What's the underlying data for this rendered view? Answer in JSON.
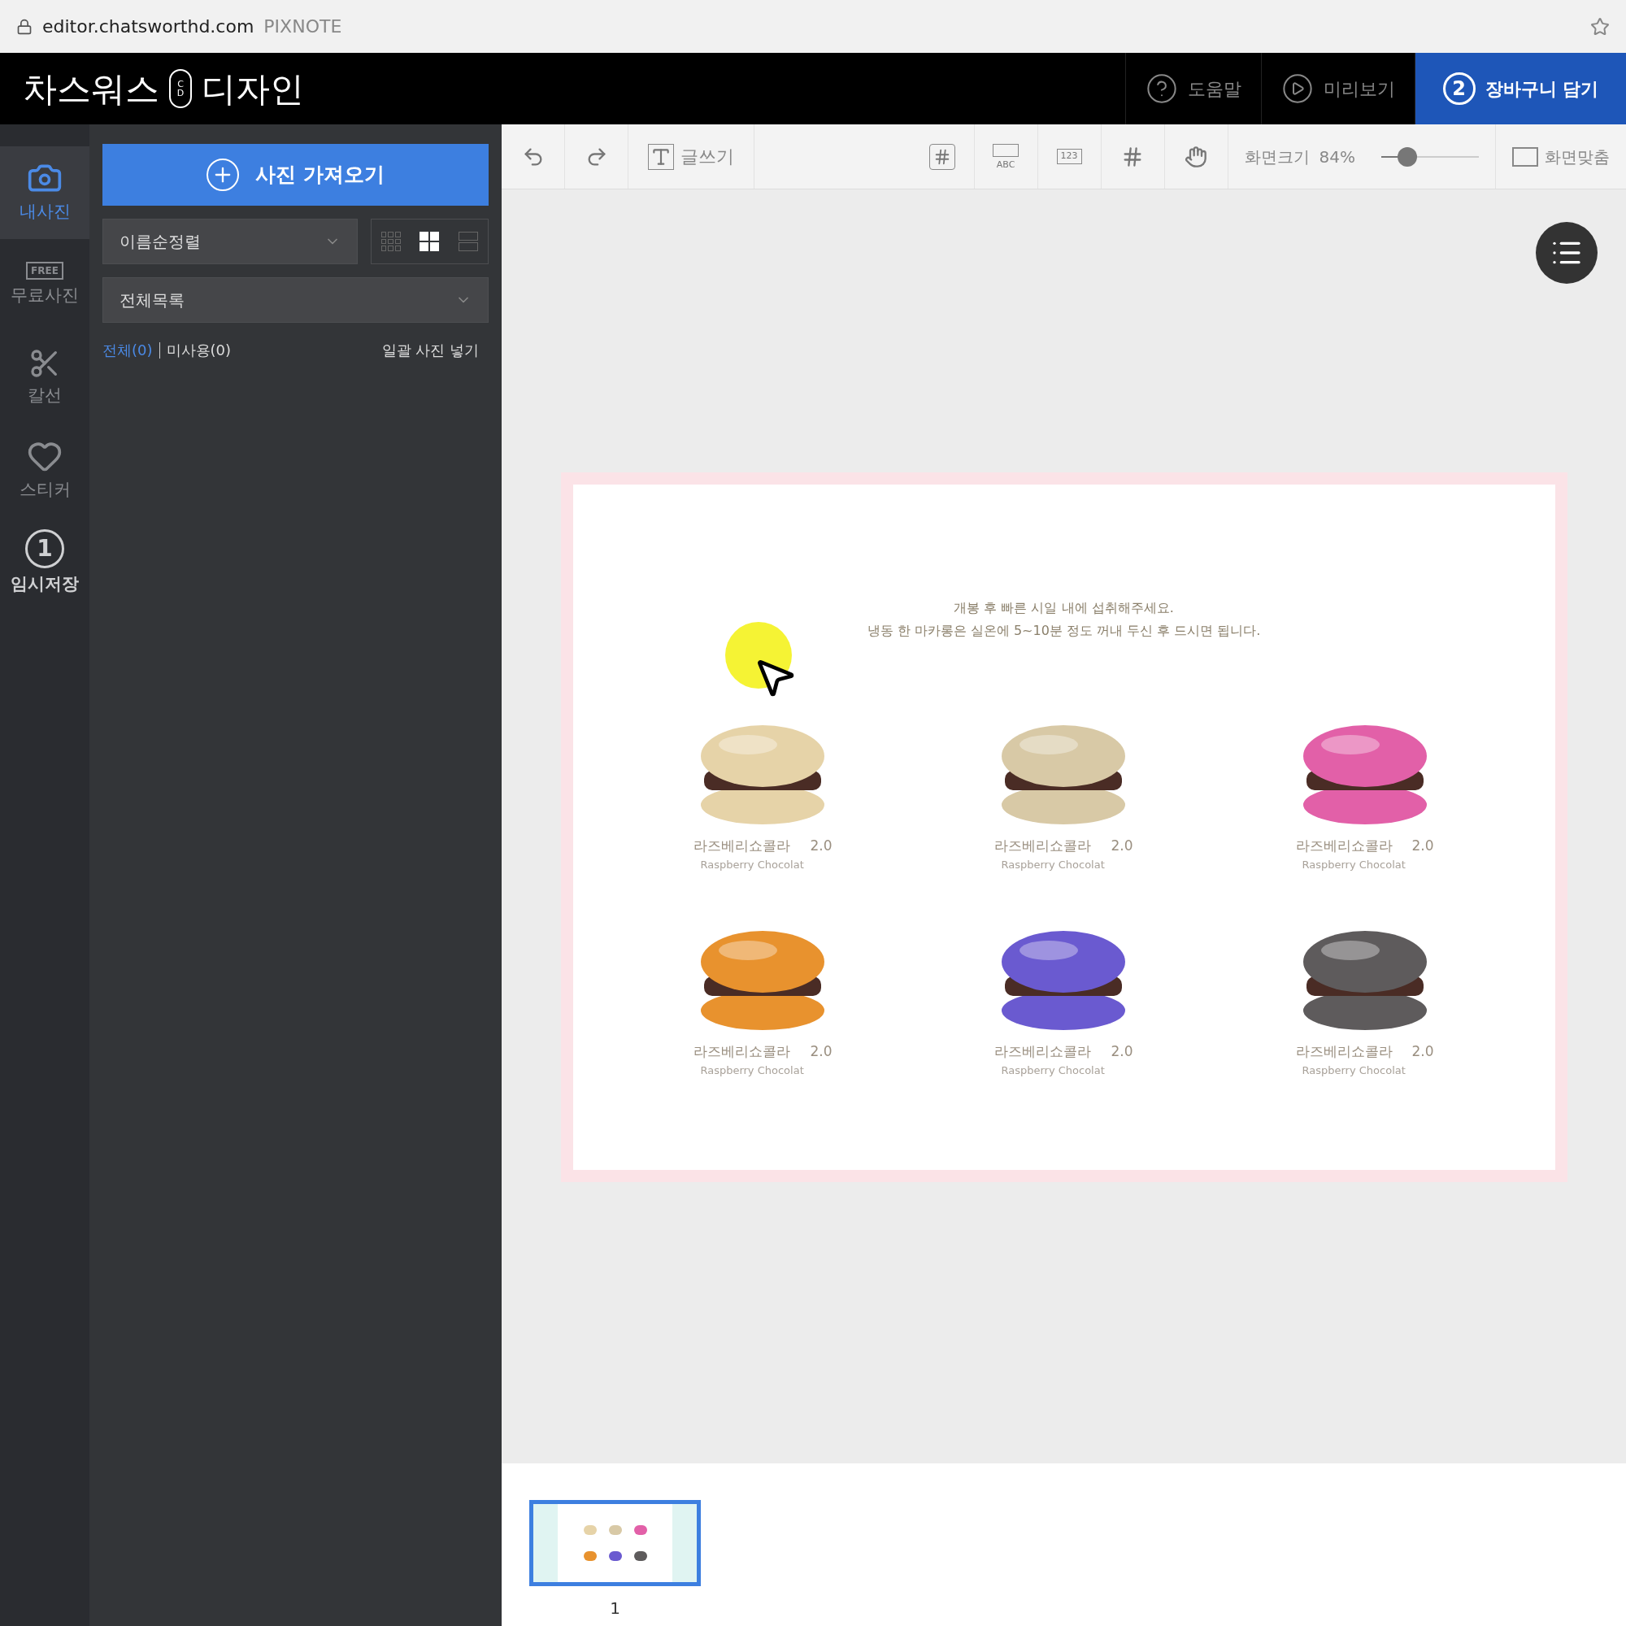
{
  "browser": {
    "url": "editor.chatsworthd.com",
    "title": "PIXNOTE"
  },
  "header": {
    "logo_left": "차스워스",
    "logo_mark": [
      "C",
      "D"
    ],
    "logo_right": "디자인",
    "buttons": [
      {
        "kind": "help",
        "label": "도움말"
      },
      {
        "kind": "preview",
        "label": "미리보기"
      },
      {
        "kind": "cart",
        "badge": "2",
        "label": "장바구니 담기"
      }
    ]
  },
  "rail": [
    {
      "kind": "photo",
      "label": "내사진",
      "selected": true
    },
    {
      "kind": "free",
      "badge": "FREE",
      "label": "무료사진",
      "selected": false
    },
    {
      "kind": "cutline",
      "label": "칼선",
      "selected": false
    },
    {
      "kind": "sticker",
      "label": "스티커",
      "selected": false
    },
    {
      "kind": "save",
      "badge": "1",
      "label": "임시저장",
      "selected": false
    }
  ],
  "panel": {
    "import_button": "사진 가져오기",
    "sort_select": "이름순정렬",
    "view_modes": [
      {
        "kind": "small",
        "selected": false
      },
      {
        "kind": "large",
        "selected": true
      },
      {
        "kind": "list",
        "selected": false
      }
    ],
    "album_select": "전체목록",
    "filters": [
      {
        "label": "전체(0)",
        "selected": true
      },
      {
        "label": "미사용(0)",
        "selected": false
      }
    ],
    "bulk_insert": "일괄 사진 넣기"
  },
  "toolbar": {
    "tools": [
      {
        "kind": "undo"
      },
      {
        "kind": "redo"
      },
      {
        "kind": "text",
        "label": "글쓰기"
      },
      {
        "kind": "hash"
      },
      {
        "kind": "abc",
        "label": "ABC"
      },
      {
        "kind": "number",
        "label": "123"
      },
      {
        "kind": "grid"
      },
      {
        "kind": "hand"
      }
    ],
    "zoom": {
      "label": "화면크기",
      "reading": "84%",
      "level": 0.27
    },
    "fit": "화면맞춤"
  },
  "page": {
    "notice": [
      "개봉 후 빠른 시일 내에 섭취해주세요.",
      "냉동 한 마카롱은 실온에 5~10분 정도 꺼내 두신 후 드시면 됩니다."
    ],
    "products": [
      {
        "name": "라즈베리쇼콜라",
        "price": "2.0",
        "subtitle": "Raspberry Chocolat",
        "color": "#e6d3a8"
      },
      {
        "name": "라즈베리쇼콜라",
        "price": "2.0",
        "subtitle": "Raspberry Chocolat",
        "color": "#d8c9a6"
      },
      {
        "name": "라즈베리쇼콜라",
        "price": "2.0",
        "subtitle": "Raspberry Chocolat",
        "color": "#e260a8"
      },
      {
        "name": "라즈베리쇼콜라",
        "price": "2.0",
        "subtitle": "Raspberry Chocolat",
        "color": "#e8922e"
      },
      {
        "name": "라즈베리쇼콜라",
        "price": "2.0",
        "subtitle": "Raspberry Chocolat",
        "color": "#6a5ad0"
      },
      {
        "name": "라즈베리쇼콜라",
        "price": "2.0",
        "subtitle": "Raspberry Chocolat",
        "color": "#5e5b5c"
      }
    ]
  },
  "filmstrip": [
    {
      "number": "1",
      "selected": true
    }
  ]
}
